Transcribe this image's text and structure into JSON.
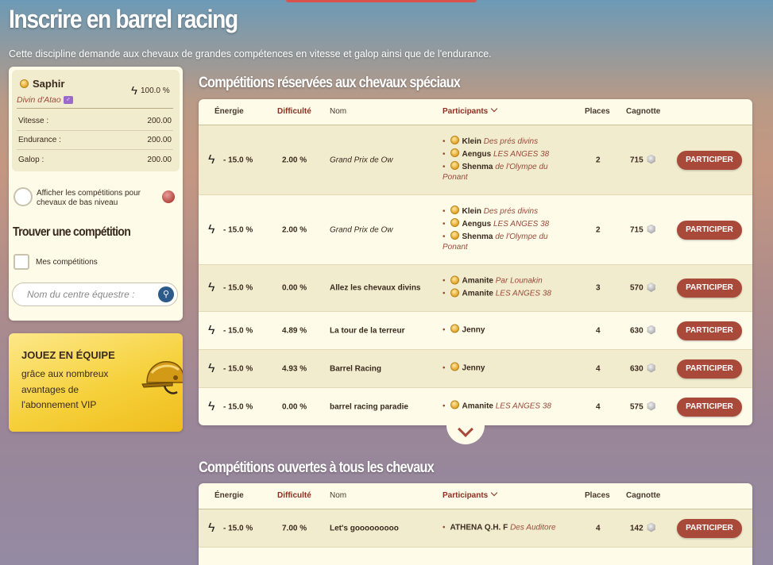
{
  "page": {
    "title": "Inscrire en barrel racing",
    "description": "Cette discipline demande aux chevaux de grandes compétences en vitesse et galop ainsi que de l'endurance."
  },
  "horse": {
    "name": "Saphir",
    "breed": "Divin d'Atao",
    "gender_symbol": "♂",
    "energy": "100.0 %",
    "stats": [
      {
        "label": "Vitesse :",
        "value": "200.00"
      },
      {
        "label": "Endurance :",
        "value": "200.00"
      },
      {
        "label": "Galop :",
        "value": "200.00"
      }
    ]
  },
  "filters": {
    "low_level_label": "Afficher les compétitions pour chevaux de bas niveau",
    "find_title": "Trouver une compétition",
    "my_competitions_label": "Mes compétitions",
    "search_placeholder": "Nom du centre équestre :"
  },
  "vip": {
    "title": "JOUEZ EN ÉQUIPE",
    "text": "grâce aux nombreux avantages de l'abonnement VIP"
  },
  "table_headers": {
    "energy": "Énergie",
    "difficulty": "Difficulté",
    "name": "Nom",
    "participants": "Participants",
    "places": "Places",
    "prize": "Cagnotte"
  },
  "special_section": {
    "title": "Compétitions réservées aux chevaux spéciaux",
    "rows": [
      {
        "energy": "- 15.0 %",
        "difficulty": "2.00 %",
        "name": "Grand Prix de Ow",
        "name_style": "italic",
        "participants": [
          {
            "name": "Klein",
            "club": "Des prés divins"
          },
          {
            "name": "Aengus",
            "club": "LES ANGES 38"
          },
          {
            "name": "Shenma",
            "club": "de l'Olympe du Ponant"
          }
        ],
        "places": "2",
        "prize": "715",
        "button": "PARTICIPER"
      },
      {
        "energy": "- 15.0 %",
        "difficulty": "2.00 %",
        "name": "Grand Prix de Ow",
        "name_style": "italic",
        "participants": [
          {
            "name": "Klein",
            "club": "Des prés divins"
          },
          {
            "name": "Aengus",
            "club": "LES ANGES 38"
          },
          {
            "name": "Shenma",
            "club": "de l'Olympe du Ponant"
          }
        ],
        "places": "2",
        "prize": "715",
        "button": "PARTICIPER"
      },
      {
        "energy": "- 15.0 %",
        "difficulty": "0.00 %",
        "name": "Allez les chevaux divins",
        "name_style": "bold",
        "participants": [
          {
            "name": "Amanite",
            "club": "Par Lounakin"
          },
          {
            "name": "Amanite",
            "club": "LES ANGES 38"
          }
        ],
        "places": "3",
        "prize": "570",
        "button": "PARTICIPER"
      },
      {
        "energy": "- 15.0 %",
        "difficulty": "4.89 %",
        "name": "La tour de la terreur",
        "name_style": "bold",
        "participants": [
          {
            "name": "Jenny",
            "club": ""
          }
        ],
        "places": "4",
        "prize": "630",
        "button": "PARTICIPER"
      },
      {
        "energy": "- 15.0 %",
        "difficulty": "4.93 %",
        "name": "Barrel Racing",
        "name_style": "bold",
        "participants": [
          {
            "name": "Jenny",
            "club": ""
          }
        ],
        "places": "4",
        "prize": "630",
        "button": "PARTICIPER"
      },
      {
        "energy": "- 15.0 %",
        "difficulty": "0.00 %",
        "name": "barrel racing paradie",
        "name_style": "bold",
        "participants": [
          {
            "name": "Amanite",
            "club": "LES ANGES 38"
          }
        ],
        "places": "4",
        "prize": "575",
        "button": "PARTICIPER"
      }
    ]
  },
  "open_section": {
    "title": "Compétitions ouvertes à tous les chevaux",
    "rows": [
      {
        "energy": "- 15.0 %",
        "difficulty": "7.00 %",
        "name": "Let's gooooooooo",
        "name_style": "bold",
        "participants": [
          {
            "name": "ATHENA Q.H. F",
            "club": "Des Auditore",
            "no_coin": true
          }
        ],
        "places": "4",
        "prize": "142",
        "button": "PARTICIPER"
      }
    ]
  }
}
